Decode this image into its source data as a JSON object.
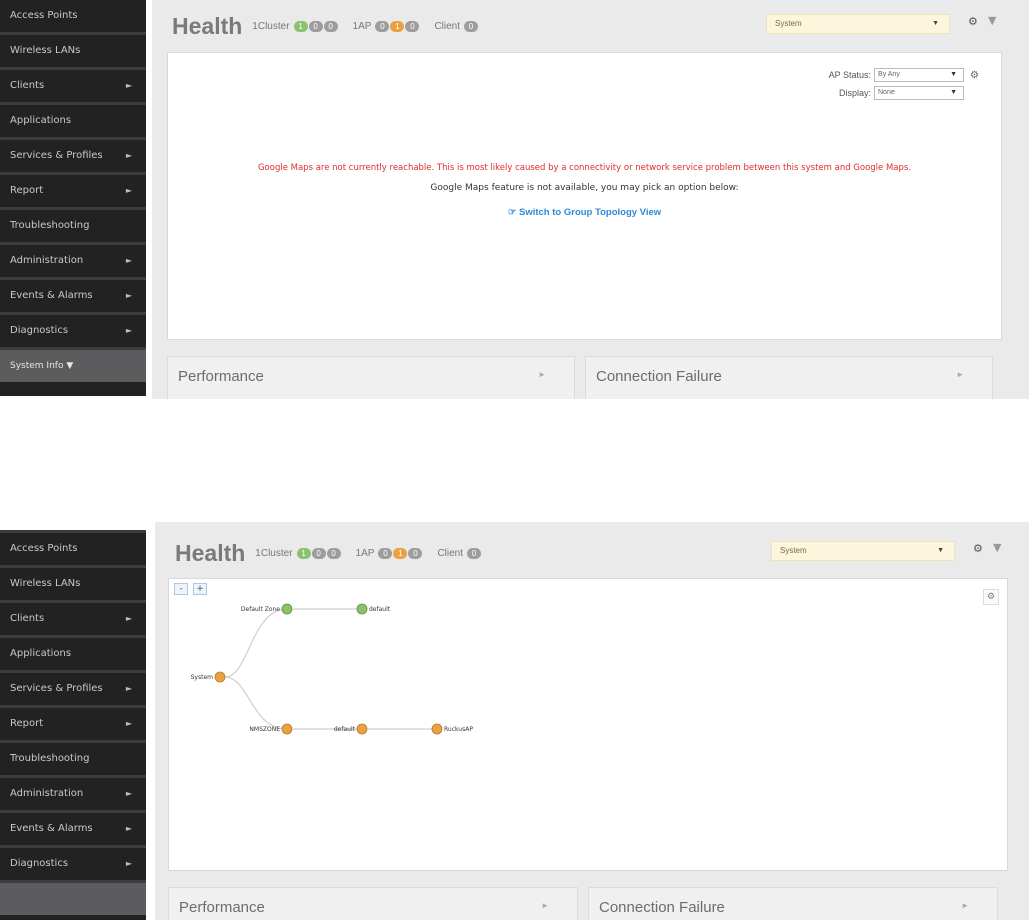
{
  "sidebar": {
    "items": [
      {
        "label": "Access Points",
        "has_arrow": false
      },
      {
        "label": "Wireless LANs",
        "has_arrow": false
      },
      {
        "label": "Clients",
        "has_arrow": true
      },
      {
        "label": "Applications",
        "has_arrow": false
      },
      {
        "label": "Services & Profiles",
        "has_arrow": true
      },
      {
        "label": "Report",
        "has_arrow": true
      },
      {
        "label": "Troubleshooting",
        "has_arrow": false
      },
      {
        "label": "Administration",
        "has_arrow": true
      },
      {
        "label": "Events & Alarms",
        "has_arrow": true
      },
      {
        "label": "Diagnostics",
        "has_arrow": true
      }
    ],
    "section_label": "System Info ▼",
    "arrow_glyph": "►"
  },
  "header": {
    "title": "Health",
    "cluster_label": "1Cluster",
    "cluster_counts": [
      "1",
      "0",
      "0"
    ],
    "ap_label": "1AP",
    "ap_counts": [
      "0",
      "1",
      "0"
    ],
    "client_label": "Client",
    "client_count": "0",
    "system_select_value": "System",
    "caret": "▼",
    "gear": "⚙",
    "funnel": "▼"
  },
  "map_panel": {
    "ap_status_label": "AP Status:",
    "ap_status_value": "By Any",
    "display_label": "Display:",
    "display_value": "None",
    "error_text": "Google Maps are not currently reachable. This is most likely caused by a connectivity or network service problem between this system and Google Maps.",
    "note_text": "Google Maps feature is not available, you may pick an option below:",
    "link_icon": "☞",
    "link_text": "Switch to Group Topology View"
  },
  "topology": {
    "zoom_out": "-",
    "zoom_in": "+",
    "gear": "⚙",
    "nodes": {
      "system": "System",
      "default_zone": "Default Zone",
      "default_wlan": "default",
      "nmszone": "NMSZONE",
      "default_group": "default",
      "ap": "RuckusAP"
    }
  },
  "tiles": {
    "performance": "Performance",
    "connection_failure": "Connection Failure",
    "arrow": "►"
  },
  "colors": {
    "sidebar_bg": "#222223",
    "content_bg": "#eaeaea",
    "green": "#8cc26b",
    "orange": "#e8a244",
    "grey": "#9d9d9d",
    "error_red": "#e32b2b",
    "link_blue": "#2f8ad6"
  }
}
